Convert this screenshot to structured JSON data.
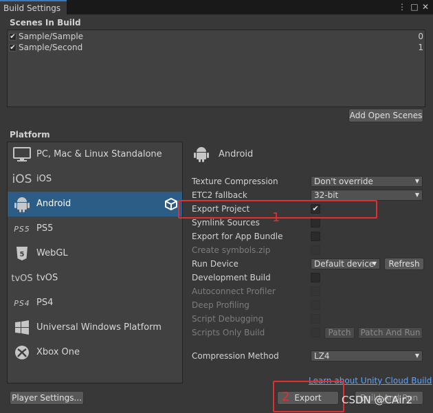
{
  "window": {
    "tab_title": "Build Settings",
    "menu_glyph": "⋮",
    "maximize_glyph": "□",
    "close_glyph": "✕"
  },
  "scenes": {
    "label": "Scenes In Build",
    "items": [
      {
        "name": "Sample/Sample",
        "index": "0",
        "checked": true
      },
      {
        "name": "Sample/Second",
        "index": "1",
        "checked": true
      }
    ],
    "add_open_scenes_label": "Add Open Scenes"
  },
  "platform": {
    "label": "Platform",
    "items": [
      {
        "label": "PC, Mac & Linux Standalone",
        "icon": "monitor-icon"
      },
      {
        "label": "iOS",
        "icon": "ios-icon",
        "icon_text": "iOS"
      },
      {
        "label": "Android",
        "icon": "android-icon"
      },
      {
        "label": "PS5",
        "icon": "ps5-icon",
        "icon_text": "PS5"
      },
      {
        "label": "WebGL",
        "icon": "html5-icon"
      },
      {
        "label": "tvOS",
        "icon": "tvos-icon",
        "icon_text": "tvOS"
      },
      {
        "label": "PS4",
        "icon": "ps4-icon",
        "icon_text": "PS4"
      },
      {
        "label": "Universal Windows Platform",
        "icon": "windows-icon"
      },
      {
        "label": "Xbox One",
        "icon": "xbox-icon"
      }
    ],
    "selected": "Android"
  },
  "android": {
    "header": "Android",
    "texture_compression": {
      "label": "Texture Compression",
      "value": "Don't override"
    },
    "etc2_fallback": {
      "label": "ETC2 fallback",
      "value": "32-bit"
    },
    "export_project": {
      "label": "Export Project",
      "checked": true
    },
    "symlink_sources": {
      "label": "Symlink Sources",
      "checked": false
    },
    "export_app_bundle": {
      "label": "Export for App Bundle",
      "checked": false
    },
    "create_symbols": {
      "label": "Create symbols.zip",
      "disabled": true
    },
    "run_device": {
      "label": "Run Device",
      "value": "Default device",
      "refresh_label": "Refresh"
    },
    "development_build": {
      "label": "Development Build",
      "checked": false
    },
    "autoconnect_profiler": {
      "label": "Autoconnect Profiler",
      "disabled": true
    },
    "deep_profiling": {
      "label": "Deep Profiling",
      "disabled": true
    },
    "script_debugging": {
      "label": "Script Debugging",
      "disabled": true
    },
    "scripts_only_build": {
      "label": "Scripts Only Build",
      "disabled": true,
      "patch_label": "Patch",
      "patch_and_run_label": "Patch And Run"
    },
    "compression_method": {
      "label": "Compression Method",
      "value": "LZ4"
    }
  },
  "footer": {
    "cloud_build_link": "Learn about Unity Cloud Build",
    "player_settings_label": "Player Settings...",
    "export_label": "Export",
    "build_and_run_label": "Build And Run"
  },
  "annotations": {
    "marker_1": "1",
    "marker_2": "2",
    "color": "#e03030"
  },
  "watermark": "CSDN @CAir2",
  "colors": {
    "selected_bg": "#2c5d87",
    "link": "#58a6ff",
    "background": "#383838"
  }
}
